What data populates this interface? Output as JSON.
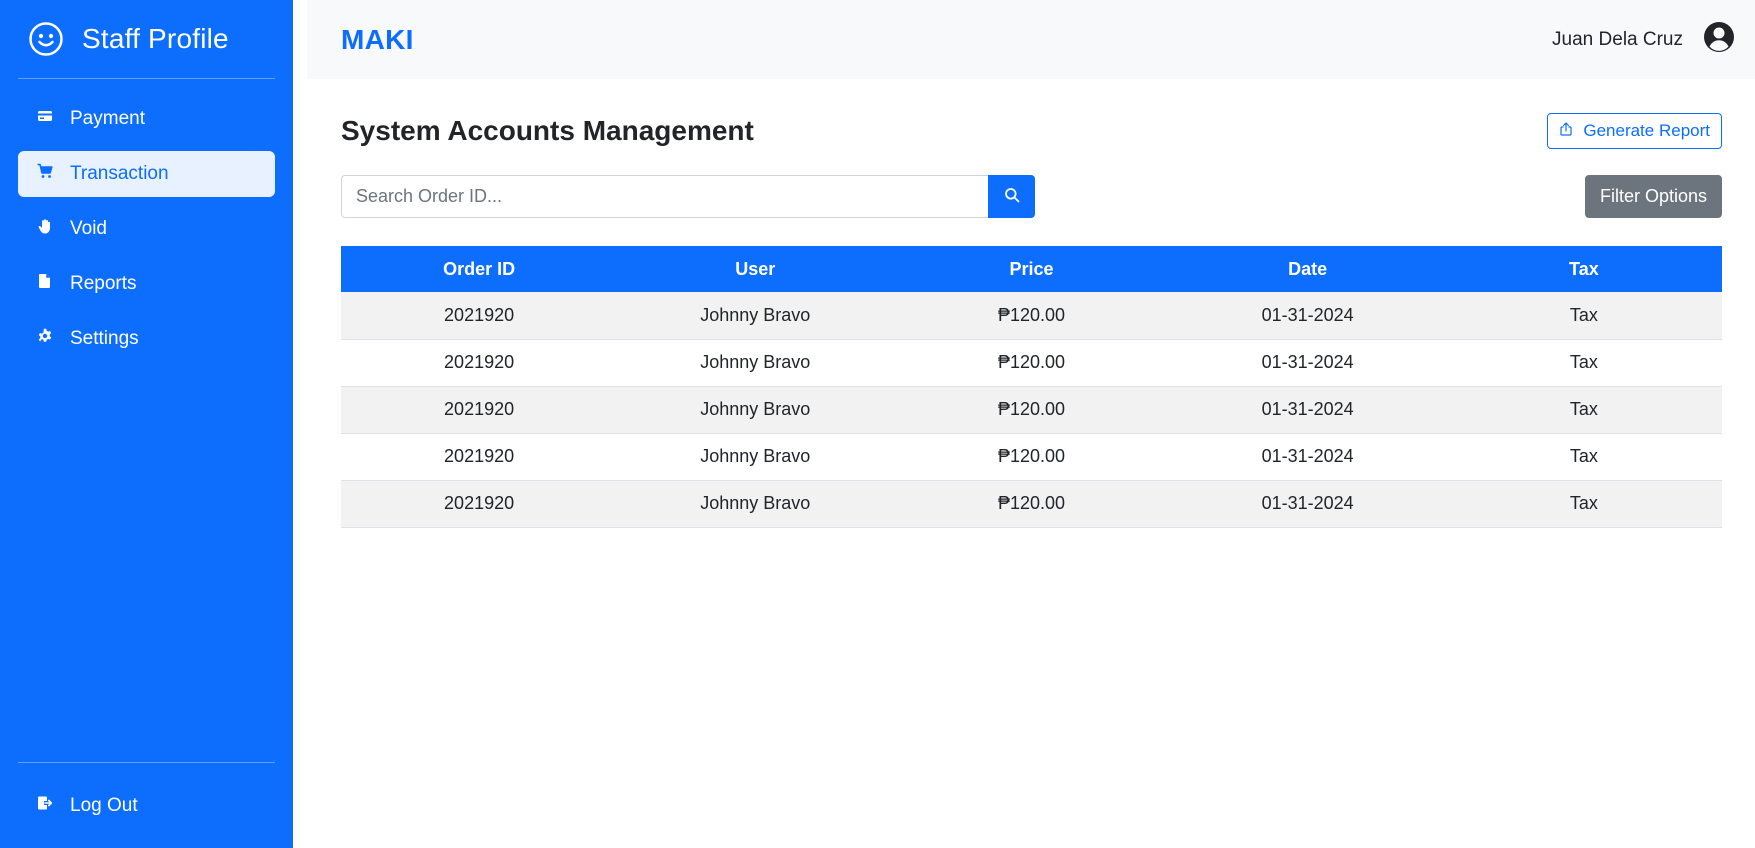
{
  "sidebar": {
    "title": "Staff Profile",
    "items": [
      {
        "label": "Payment",
        "icon": "credit-card-icon",
        "active": false
      },
      {
        "label": "Transaction",
        "icon": "cart-icon",
        "active": true
      },
      {
        "label": "Void",
        "icon": "hand-icon",
        "active": false
      },
      {
        "label": "Reports",
        "icon": "file-icon",
        "active": false
      },
      {
        "label": "Settings",
        "icon": "gear-icon",
        "active": false
      }
    ],
    "logout_label": "Log Out"
  },
  "topbar": {
    "brand": "MAKI",
    "user_name": "Juan Dela Cruz"
  },
  "page": {
    "title": "System Accounts Management",
    "generate_report_label": "Generate Report",
    "search_placeholder": "Search Order ID...",
    "filter_label": "Filter Options"
  },
  "table": {
    "columns": [
      "Order ID",
      "User",
      "Price",
      "Date",
      "Tax"
    ],
    "rows": [
      [
        "2021920",
        "Johnny Bravo",
        "₱120.00",
        "01-31-2024",
        "Tax"
      ],
      [
        "2021920",
        "Johnny Bravo",
        "₱120.00",
        "01-31-2024",
        "Tax"
      ],
      [
        "2021920",
        "Johnny Bravo",
        "₱120.00",
        "01-31-2024",
        "Tax"
      ],
      [
        "2021920",
        "Johnny Bravo",
        "₱120.00",
        "01-31-2024",
        "Tax"
      ],
      [
        "2021920",
        "Johnny Bravo",
        "₱120.00",
        "01-31-2024",
        "Tax"
      ]
    ]
  },
  "colors": {
    "primary": "#0d6efd",
    "secondary": "#6c757d",
    "active_nav_bg": "#e8f1ff"
  }
}
